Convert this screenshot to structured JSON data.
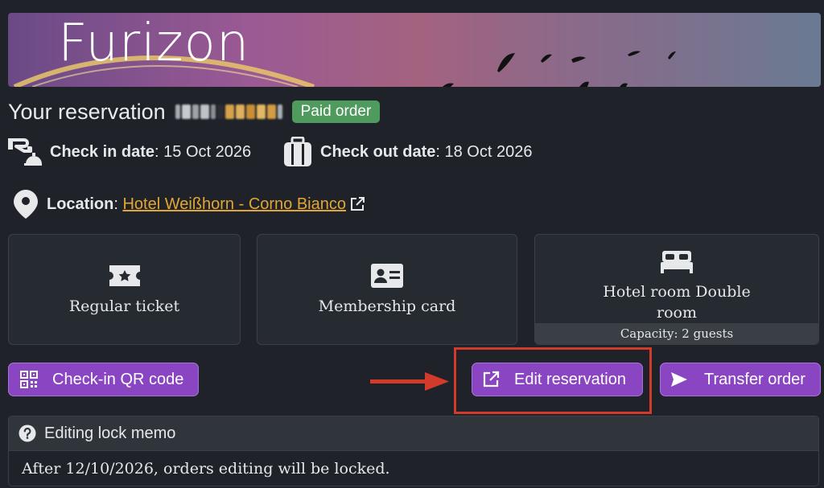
{
  "banner": {
    "brand": "Furizon"
  },
  "reservation": {
    "title": "Your reservation",
    "status_badge": "Paid order",
    "checkin_label": "Check in date",
    "checkin_value": ": 15 Oct 2026",
    "checkout_label": "Check out date",
    "checkout_value": ": 18 Oct 2026",
    "location_label": "Location",
    "location_sep": ": ",
    "location_value": "Hotel Weißhorn - Corno Bianco"
  },
  "cards": [
    {
      "label": "Regular ticket",
      "icon": "ticket-icon"
    },
    {
      "label": "Membership card",
      "icon": "id-card-icon"
    },
    {
      "label": "Hotel room Double room",
      "icon": "bed-icon",
      "caption": "Capacity: 2 guests"
    }
  ],
  "actions": {
    "qr_label": "Check-in QR code",
    "edit_label": "Edit reservation",
    "transfer_label": "Transfer order"
  },
  "memo": {
    "title": "Editing lock memo",
    "text": "After 12/10/2026, orders editing will be locked."
  },
  "colors": {
    "accent": "#8a46c2",
    "paid": "#4f9a5d",
    "link": "#e2a636",
    "highlight": "#d23a2b"
  }
}
